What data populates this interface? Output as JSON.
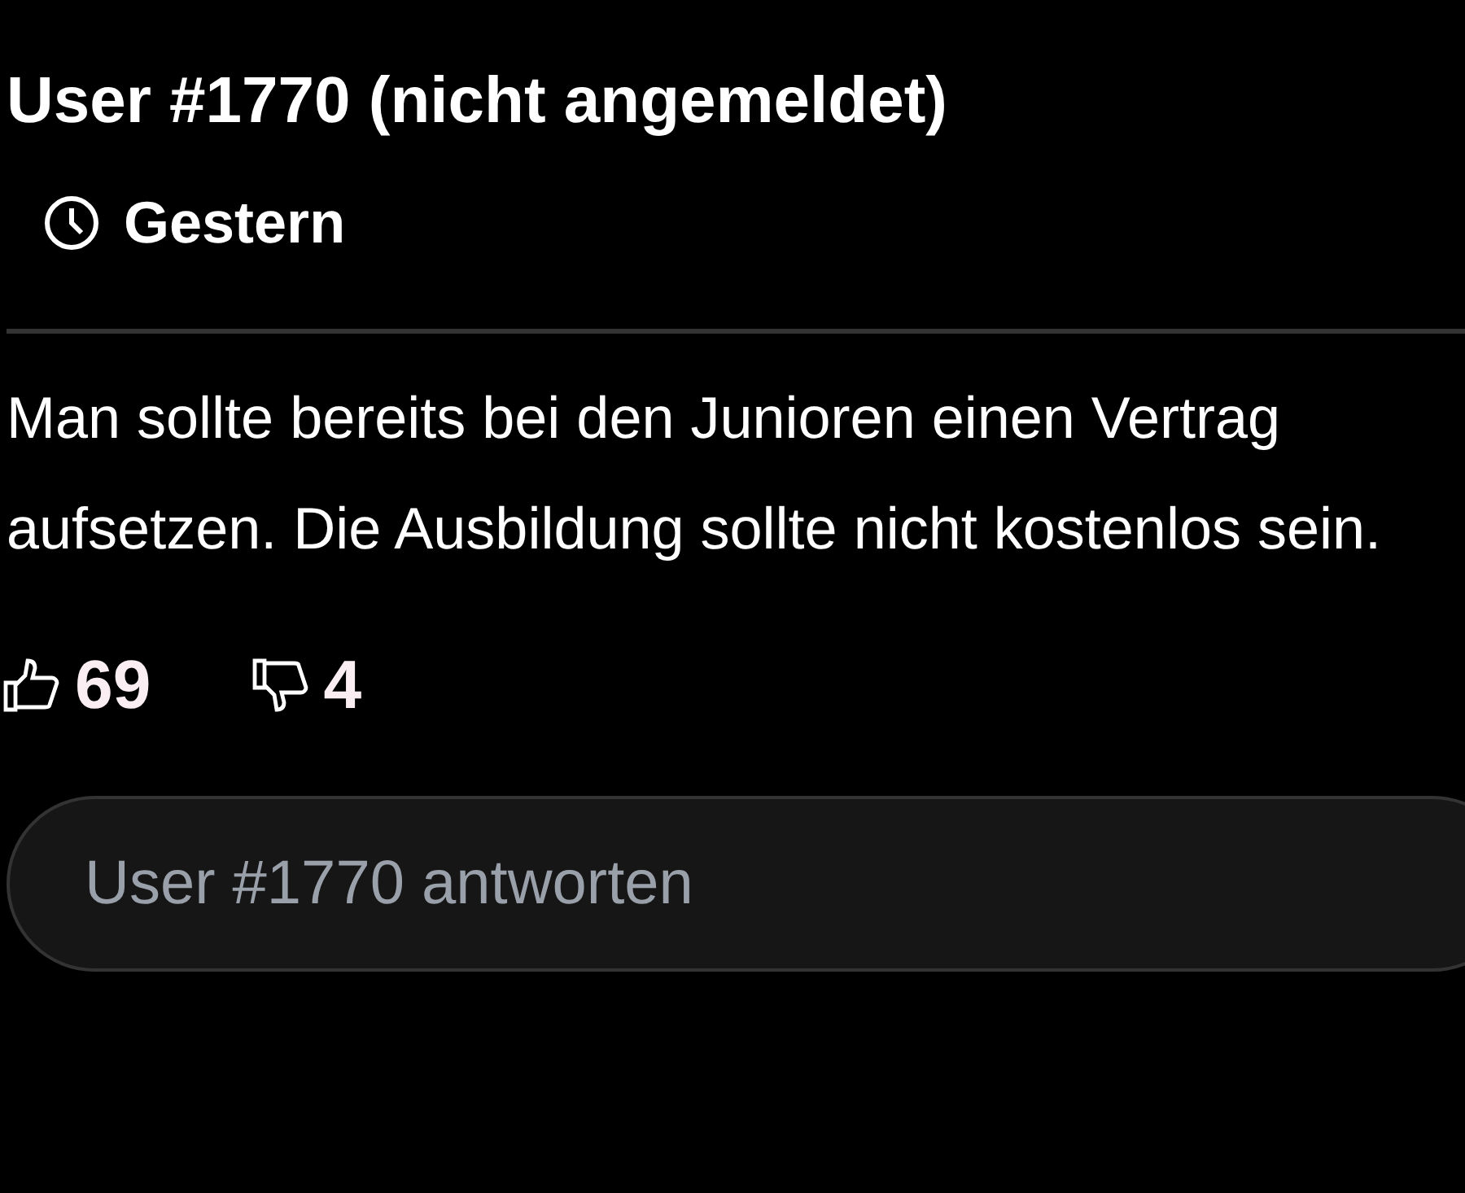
{
  "comment": {
    "author": "User #1770 (nicht angemeldet)",
    "time": "Gestern",
    "text": "Man sollte bereits bei den Junioren einen Vertrag aufsetzen. Die Ausbildung sollte nicht kostenlos sein.",
    "likes": "69",
    "dislikes": "4"
  },
  "reply": {
    "placeholder": "User #1770 antworten"
  }
}
